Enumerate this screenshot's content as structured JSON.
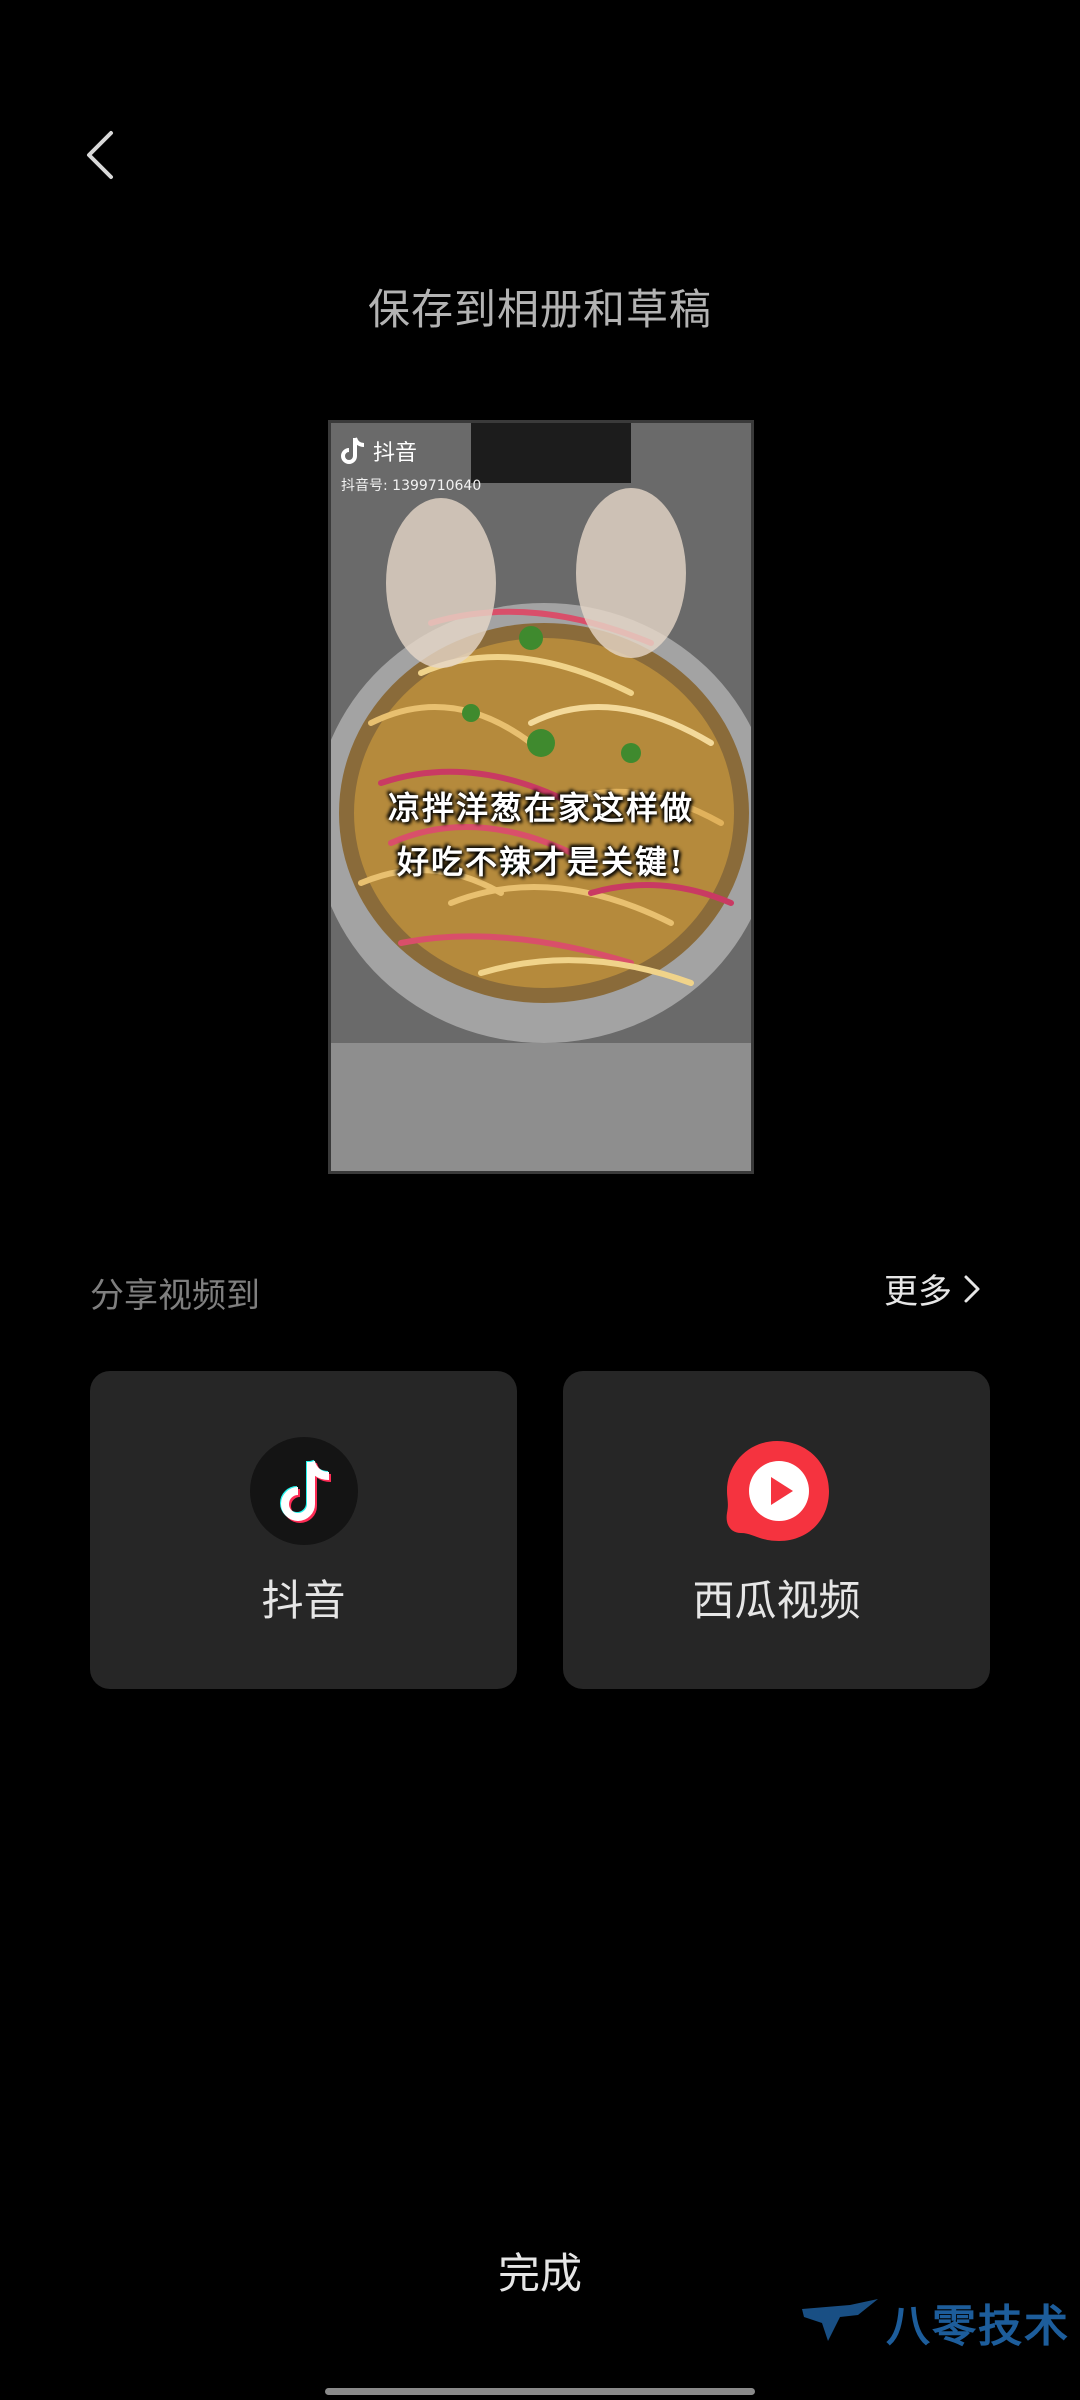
{
  "header": {
    "back_icon": "chevron-left-icon",
    "title": "保存到相册和草稿"
  },
  "preview": {
    "watermark_app": "抖音",
    "watermark_id": "抖音号: 1399710640",
    "caption_line1": "凉拌洋葱在家这样做",
    "caption_line2": "好吃不辣才是关键!"
  },
  "share": {
    "label": "分享视频到",
    "more_label": "更多",
    "targets": [
      {
        "label": "抖音",
        "icon": "douyin-logo-icon",
        "color": "#1a1a1a"
      },
      {
        "label": "西瓜视频",
        "icon": "xigua-video-logo-icon",
        "color": "#f5333f"
      }
    ]
  },
  "footer": {
    "done_label": "完成",
    "brand_watermark": "八零技术"
  }
}
